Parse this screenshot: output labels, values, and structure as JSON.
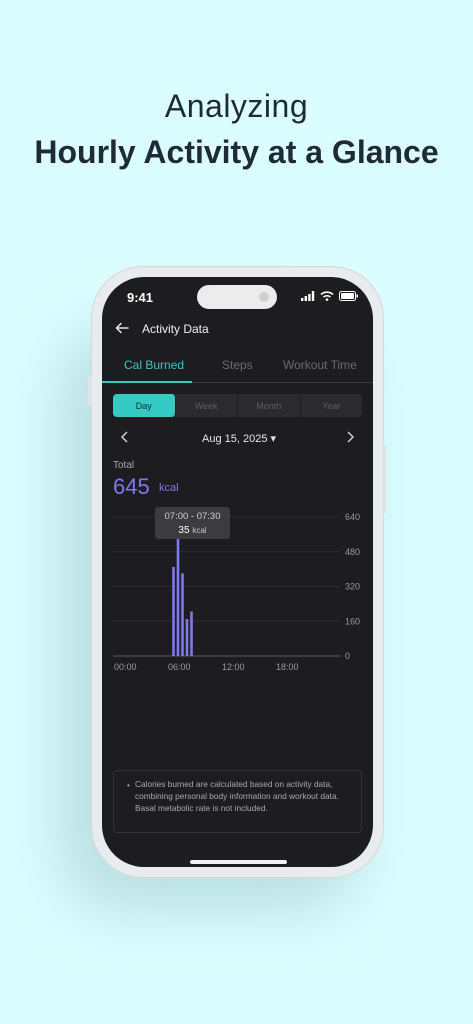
{
  "headline": {
    "line1": "Analyzing",
    "line2": "Hourly Activity at a Glance"
  },
  "status_bar": {
    "time": "9:41"
  },
  "nav": {
    "title": "Activity Data"
  },
  "tabs": [
    {
      "label": "Cal Burned",
      "active": true
    },
    {
      "label": "Steps",
      "active": false
    },
    {
      "label": "Workout Time",
      "active": false
    }
  ],
  "period_selector": [
    {
      "label": "Day",
      "active": true
    },
    {
      "label": "Week",
      "active": false
    },
    {
      "label": "Month",
      "active": false
    },
    {
      "label": "Year",
      "active": false
    }
  ],
  "date": {
    "label": "Aug 15, 2025 ▾"
  },
  "total": {
    "label": "Total",
    "value": "645",
    "unit": "kcal"
  },
  "tooltip": {
    "range": "07:00 - 07:30",
    "value": "35",
    "unit": "kcal"
  },
  "chart_data": {
    "type": "bar",
    "x_ticks": [
      "00:00",
      "06:00",
      "12:00",
      "18:00"
    ],
    "y_ticks": [
      "640",
      "480",
      "320",
      "160",
      "0"
    ],
    "ylim": [
      0,
      640
    ],
    "bar_color": "#7f79f0",
    "x_unit": "hours",
    "bars": [
      {
        "x": 6.5,
        "value": 410
      },
      {
        "x": 7.0,
        "value": 540
      },
      {
        "x": 7.5,
        "value": 380
      },
      {
        "x": 8.0,
        "value": 170
      },
      {
        "x": 8.5,
        "value": 205
      }
    ]
  },
  "note": {
    "bullet": "•",
    "text": "Calories burned are calculated based on activity data, combining personal body information and workout data. Basal metabolic rate is not included."
  },
  "colors": {
    "background": "#dcfdff",
    "accent_teal": "#37c9c4",
    "accent_purple": "#7f79f0",
    "screen": "#1d1d1f"
  }
}
